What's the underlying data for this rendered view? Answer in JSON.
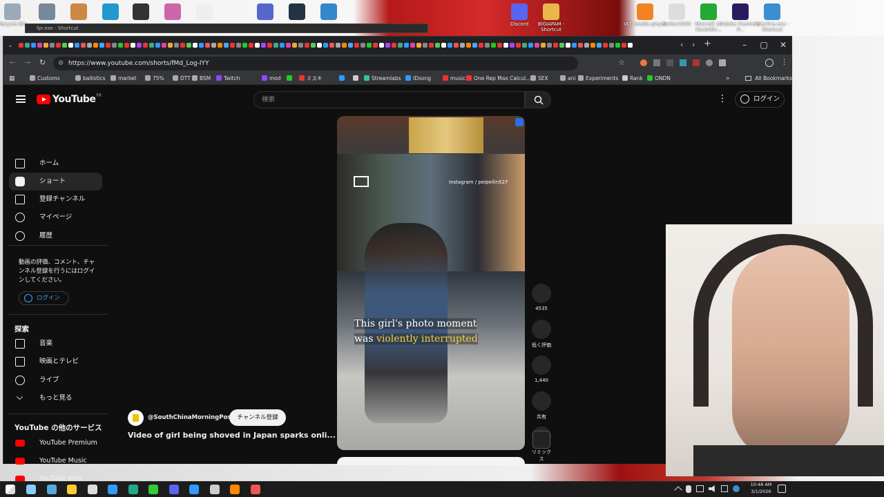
{
  "desktop": {
    "icons": [
      {
        "label": "Recycle Bin",
        "color": "#9ab"
      },
      {
        "label": "",
        "color": "#789"
      },
      {
        "label": "",
        "color": "#c84"
      },
      {
        "label": "",
        "color": "#29c"
      },
      {
        "label": "",
        "color": "#333"
      },
      {
        "label": "",
        "color": "#c6a"
      },
      {
        "label": "",
        "color": "#eee"
      },
      {
        "label": "",
        "color": "#56c"
      },
      {
        "label": "",
        "color": "#234"
      },
      {
        "label": "",
        "color": "#38c"
      },
      {
        "label": "Discord",
        "color": "#5865f2"
      },
      {
        "label": "BIGIAPAM - Shortcut",
        "color": "#e8b84a"
      },
      {
        "label": "VLC media player",
        "color": "#f58220"
      },
      {
        "label": "foobar2000",
        "color": "#ddd"
      },
      {
        "label": "Mixcraft 10 Recordin...",
        "color": "#2a3"
      },
      {
        "label": "Adobe Premiere P...",
        "color": "#2a1a5e"
      },
      {
        "label": "kdenlive.exe - Shortcut",
        "color": "#3a8fd0"
      }
    ],
    "small_window_title": "fpr.exe - Shortcut"
  },
  "browser": {
    "url": "https://www.youtube.com/shorts/fMd_Log-IYY",
    "tab_colors": [
      "#e33",
      "#4a8",
      "#39f",
      "#d4a",
      "#ea3",
      "#888",
      "#e33",
      "#5c5",
      "#fff",
      "#39f",
      "#e55",
      "#aaa",
      "#f80",
      "#4af",
      "#e33",
      "#888",
      "#2c2",
      "#e33",
      "#fff",
      "#a4f"
    ],
    "bookmarks": [
      {
        "label": "Customs",
        "color": "#aaa"
      },
      {
        "label": "ballistics",
        "color": "#aaa"
      },
      {
        "label": "market",
        "color": "#aaa"
      },
      {
        "label": "75%",
        "color": "#aaa"
      },
      {
        "label": "DTT",
        "color": "#aaa"
      },
      {
        "label": "BSM",
        "color": "#aaa"
      },
      {
        "label": "Twitch",
        "color": "#9146ff"
      },
      {
        "label": "mod",
        "color": "#9146ff"
      },
      {
        "label": "",
        "color": "#2c2"
      },
      {
        "label": "ミスキ",
        "color": "#e33"
      },
      {
        "label": "",
        "color": "#39f"
      },
      {
        "label": "",
        "color": "#ccc"
      },
      {
        "label": "Streamlabs",
        "color": "#31c3a2"
      },
      {
        "label": "IDsong",
        "color": "#39f"
      },
      {
        "label": "music",
        "color": "#e33"
      },
      {
        "label": "One Rep Max Calcul...",
        "color": "#e33"
      },
      {
        "label": "SEX",
        "color": "#aaa"
      },
      {
        "label": "ani",
        "color": "#aaa"
      },
      {
        "label": "Experiments",
        "color": "#aaa"
      },
      {
        "label": "Rank",
        "color": "#ccc"
      },
      {
        "label": "ONDN",
        "color": "#2c2"
      }
    ],
    "all_bookmarks": "All Bookmarks"
  },
  "youtube": {
    "logo_text": "YouTube",
    "country": "FR",
    "search_placeholder": "検索",
    "login": "ログイン",
    "nav": [
      {
        "label": "ホーム",
        "icon": "home-icon"
      },
      {
        "label": "ショート",
        "icon": "shorts-icon"
      },
      {
        "label": "登録チャンネル",
        "icon": "subscriptions-icon"
      },
      {
        "label": "マイページ",
        "icon": "you-icon"
      },
      {
        "label": "履歴",
        "icon": "history-icon"
      }
    ],
    "login_prompt": "動画の評価、コメント、チャンネル登録を行うにはログインしてください。",
    "login_button": "ログイン",
    "explore_heading": "探索",
    "explore": [
      {
        "label": "音楽",
        "icon": "music-icon"
      },
      {
        "label": "映画とテレビ",
        "icon": "movies-icon"
      },
      {
        "label": "ライブ",
        "icon": "live-icon"
      },
      {
        "label": "もっと見る",
        "icon": "chevron-down-icon"
      }
    ],
    "more_heading": "YouTube の他のサービス",
    "services": [
      {
        "label": "YouTube Premium",
        "color": "#ff0000"
      },
      {
        "label": "YouTube Music",
        "color": "#ff0000"
      },
      {
        "label": "YouTube Kids",
        "color": "#ff0000"
      }
    ],
    "short": {
      "watermark": "Instagram / peipeilin527",
      "caption_plain": "This girl's photo moment was ",
      "caption_highlight": "violently interrupted",
      "channel": "@SouthChinaMorningPost",
      "subscribe": "チャンネル登録",
      "title": "Video of girl being shoved in Japan sparks onli..."
    },
    "actions": [
      {
        "label": "4535",
        "icon": "like-icon"
      },
      {
        "label": "低く評価",
        "icon": "dislike-icon"
      },
      {
        "label": "1,440",
        "icon": "comment-icon"
      },
      {
        "label": "共有",
        "icon": "share-icon"
      },
      {
        "label": "リミックス",
        "icon": "remix-icon"
      }
    ]
  },
  "taskbar": {
    "time": "10:48 AM",
    "date": "3/1/2026",
    "apps": [
      "#8cf",
      "#5ad",
      "#fc3",
      "#ddd",
      "#39f",
      "#2a8",
      "#3c3",
      "#5865f2",
      "#39f",
      "#ccc",
      "#f80",
      "#e55"
    ]
  }
}
